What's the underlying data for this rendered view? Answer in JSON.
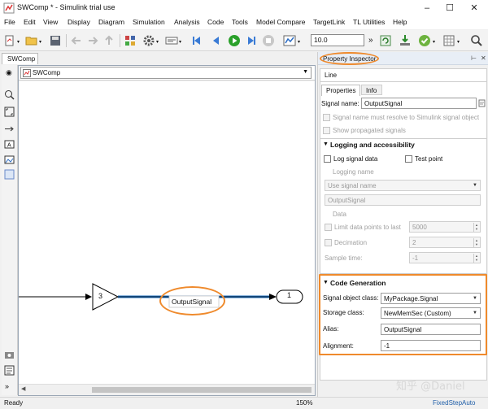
{
  "window": {
    "title": "SWComp * - Simulink trial use",
    "controls": {
      "minimize": "–",
      "maximize": "☐",
      "close": "✕"
    }
  },
  "menu": [
    "File",
    "Edit",
    "View",
    "Display",
    "Diagram",
    "Simulation",
    "Analysis",
    "Code",
    "Tools",
    "Model Compare",
    "TargetLink",
    "TL Utilities",
    "Help"
  ],
  "toolbar": {
    "stop_time": "10.0"
  },
  "tabs": {
    "model_tab": "SWComp"
  },
  "breadcrumb": {
    "model": "SWComp"
  },
  "diagram": {
    "gain_value": "3",
    "signal_label": "OutputSignal",
    "outport_number": "1",
    "line_color": "#1f6fbf"
  },
  "inspector": {
    "panel_title": "Property Inspector",
    "object_type": "Line",
    "tabs": [
      "Properties",
      "Info"
    ],
    "signal_name_label": "Signal name:",
    "signal_name_value": "OutputSignal",
    "must_resolve_label": "Signal name must resolve to Simulink signal object",
    "show_propagated_label": "Show propagated signals",
    "logging_section": "Logging and accessibility",
    "log_signal_data": "Log signal data",
    "test_point": "Test point",
    "logging_name_label": "Logging name",
    "logging_name_mode": "Use signal name",
    "logging_name_value": "OutputSignal",
    "data_label": "Data",
    "limit_points_label": "Limit data points to last",
    "limit_points_value": "5000",
    "decimation_label": "Decimation",
    "decimation_value": "2",
    "sample_time_label": "Sample time:",
    "sample_time_value": "-1",
    "code_gen_section": "Code Generation",
    "signal_object_class_label": "Signal object class:",
    "signal_object_class_value": "MyPackage.Signal",
    "storage_class_label": "Storage class:",
    "storage_class_value": "NewMemSec (Custom)",
    "alias_label": "Alias:",
    "alias_value": "OutputSignal",
    "alignment_label": "Alignment:",
    "alignment_value": "-1"
  },
  "status": {
    "left": "Ready",
    "zoom": "150%",
    "solver": "FixedStepAuto"
  },
  "watermark": "知乎 @Daniel",
  "colors": {
    "highlight": "#ef8a2c",
    "accent": "#1f6fbf"
  }
}
